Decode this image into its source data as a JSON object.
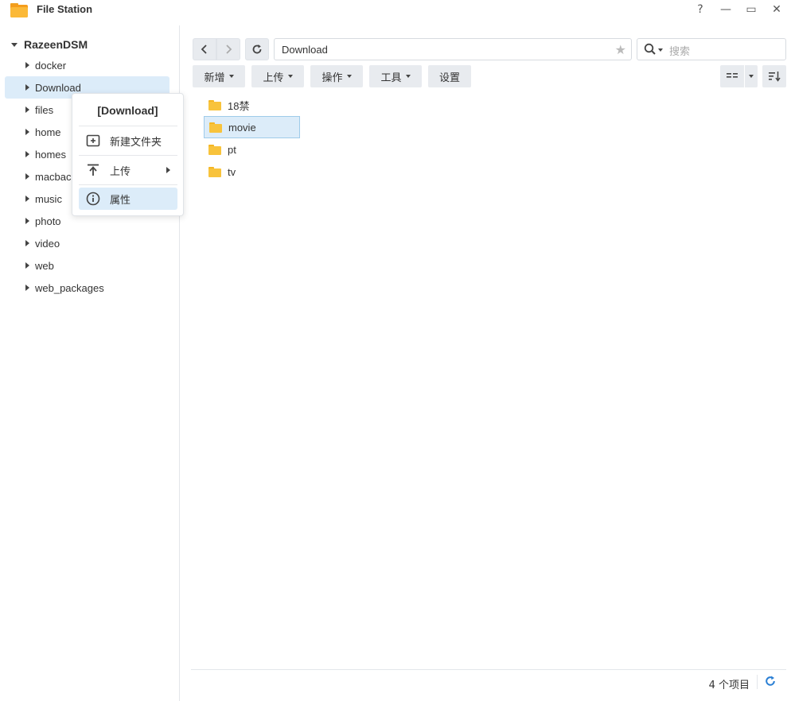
{
  "window": {
    "title": "File Station",
    "help": "?",
    "minimize": "—",
    "maximize": "▭",
    "close": "✕"
  },
  "sidebar": {
    "root": "RazeenDSM",
    "items": [
      {
        "label": "docker"
      },
      {
        "label": "Download",
        "selected": true
      },
      {
        "label": "files"
      },
      {
        "label": "home"
      },
      {
        "label": "homes"
      },
      {
        "label": "macbac"
      },
      {
        "label": "music"
      },
      {
        "label": "photo"
      },
      {
        "label": "video"
      },
      {
        "label": "web"
      },
      {
        "label": "web_packages"
      }
    ]
  },
  "toolbar": {
    "path": "Download",
    "search_placeholder": "搜索",
    "buttons": {
      "new": "新增",
      "upload": "上传",
      "action": "操作",
      "tools": "工具",
      "settings": "设置"
    }
  },
  "files": [
    {
      "name": "18禁"
    },
    {
      "name": "movie",
      "selected": true
    },
    {
      "name": "pt"
    },
    {
      "name": "tv"
    }
  ],
  "status": {
    "count": "4 个项目"
  },
  "context_menu": {
    "title": "[Download]",
    "items": {
      "new_folder": "新建文件夹",
      "upload": "上传",
      "properties": "属性"
    }
  },
  "colors": {
    "selection": "#dcecf9",
    "folder": "#f8c33c",
    "accent": "#2a7fd4"
  }
}
